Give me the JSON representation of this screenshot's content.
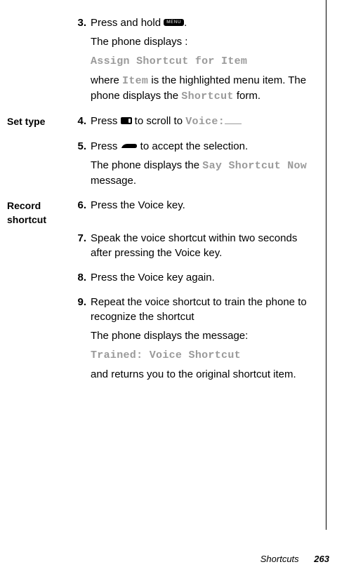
{
  "sections": [
    {
      "label": "",
      "steps": [
        {
          "num": "3.",
          "lines": [
            {
              "frags": [
                {
                  "t": "Press and hold "
                },
                {
                  "icon": "menu"
                },
                {
                  "t": "."
                }
              ]
            },
            {
              "cls": "sp",
              "frags": [
                {
                  "t": "The phone displays :"
                }
              ]
            },
            {
              "cls": "sp",
              "frags": [
                {
                  "lcd": "Assign Shortcut for Item"
                }
              ]
            },
            {
              "cls": "sp",
              "frags": [
                {
                  "t": "where "
                },
                {
                  "lcd": "Item"
                },
                {
                  "t": " is the highlighted menu item. The phone displays the "
                },
                {
                  "lcd": "Shortcut"
                },
                {
                  "t": " form."
                }
              ]
            }
          ]
        }
      ]
    },
    {
      "label": "Set type",
      "steps": [
        {
          "num": "4.",
          "lines": [
            {
              "frags": [
                {
                  "t": "Press "
                },
                {
                  "icon": "scroll"
                },
                {
                  "t": " to scroll to "
                },
                {
                  "lcd": "Voice"
                },
                {
                  "lcd": ":"
                },
                {
                  "blank": true
                }
              ]
            }
          ]
        },
        {
          "num": "5.",
          "lines": [
            {
              "frags": [
                {
                  "t": "Press "
                },
                {
                  "icon": "send"
                },
                {
                  "t": " to accept the selection."
                }
              ]
            },
            {
              "cls": "sp",
              "frags": [
                {
                  "t": "The phone displays the "
                },
                {
                  "lcd": "Say Shortcut Now"
                },
                {
                  "t": " message."
                }
              ]
            }
          ]
        }
      ]
    },
    {
      "label": "Record shortcut",
      "steps": [
        {
          "num": "6.",
          "lines": [
            {
              "frags": [
                {
                  "t": "Press the Voice key."
                }
              ]
            }
          ]
        },
        {
          "num": "7.",
          "lines": [
            {
              "frags": [
                {
                  "t": "Speak the voice shortcut within two seconds after pressing the Voice key."
                }
              ]
            }
          ]
        },
        {
          "num": "8.",
          "lines": [
            {
              "frags": [
                {
                  "t": "Press the Voice key again."
                }
              ]
            }
          ]
        },
        {
          "num": "9.",
          "lines": [
            {
              "frags": [
                {
                  "t": "Repeat the voice shortcut to train the phone to recognize the shortcut"
                }
              ]
            },
            {
              "cls": "sp",
              "frags": [
                {
                  "t": "The phone displays the message:"
                }
              ]
            },
            {
              "cls": "sp",
              "frags": [
                {
                  "lcd": "Trained: Voice Shortcut"
                }
              ]
            },
            {
              "cls": "sp",
              "frags": [
                {
                  "t": "and returns you to the original shortcut item."
                }
              ]
            }
          ]
        }
      ]
    }
  ],
  "footer": {
    "section": "Shortcuts",
    "page": "263"
  }
}
